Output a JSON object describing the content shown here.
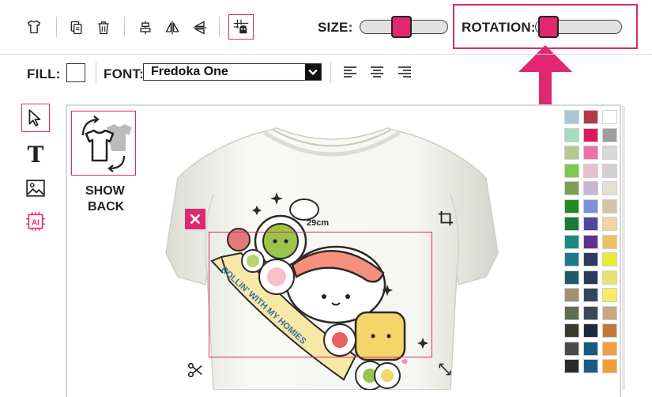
{
  "toolbar": {
    "size_label": "SIZE:",
    "size_value": 0.45,
    "rotation_label": "ROTATION:",
    "rotation_value": 0.05
  },
  "format_bar": {
    "fill_label": "FILL:",
    "font_label": "FONT:",
    "font_value": "Fredoka One"
  },
  "panel": {
    "show_back_line1": "SHOW",
    "show_back_line2": "BACK"
  },
  "design": {
    "width_label": "29cm",
    "banner_text": "ROLLIN' WITH MY HOMIES"
  },
  "colors": {
    "accent": "#e0276f",
    "palette": [
      [
        "#a8c8d8",
        "#b23a48",
        "#ffffff"
      ],
      [
        "#a8dcc0",
        "#d81b60",
        "#9e9e9e"
      ],
      [
        "#b5c890",
        "#f06fa8",
        "#d8d8d8"
      ],
      [
        "#7ec850",
        "#e8c0d0",
        "#d4d0d0"
      ],
      [
        "#7aa050",
        "#c8b4d4",
        "#e4e0d4"
      ],
      [
        "#1e8c1e",
        "#8090d8",
        "#d4c4a4"
      ],
      [
        "#1a7a3a",
        "#5048a0",
        "#f4d4a0"
      ],
      [
        "#1a8a7a",
        "#603090",
        "#f0c060"
      ],
      [
        "#1a7a8a",
        "#303a60",
        "#e8ec30"
      ],
      [
        "#205a6a",
        "#2a3a5a",
        "#e8e070"
      ],
      [
        "#a09070",
        "#304860",
        "#f8ec60"
      ],
      [
        "#5a7050",
        "#3a4a5a",
        "#c8a880"
      ],
      [
        "#3a3a2a",
        "#1a2a40",
        "#c07a3a"
      ],
      [
        "#4a4a4a",
        "#1a5a7a",
        "#f0a040"
      ],
      [
        "#2a2a2a",
        "#1a5a8a",
        "#f0a030"
      ]
    ]
  },
  "icons": [
    "tshirt-icon",
    "copy-icon",
    "trash-icon",
    "align-center-vertical-icon",
    "flip-horizontal-icon",
    "flip-vertical-icon",
    "grid-snap-icon",
    "pointer-icon",
    "text-icon",
    "image-icon",
    "ai-icon",
    "close-icon",
    "crop-icon",
    "scissors-icon",
    "resize-icon"
  ]
}
